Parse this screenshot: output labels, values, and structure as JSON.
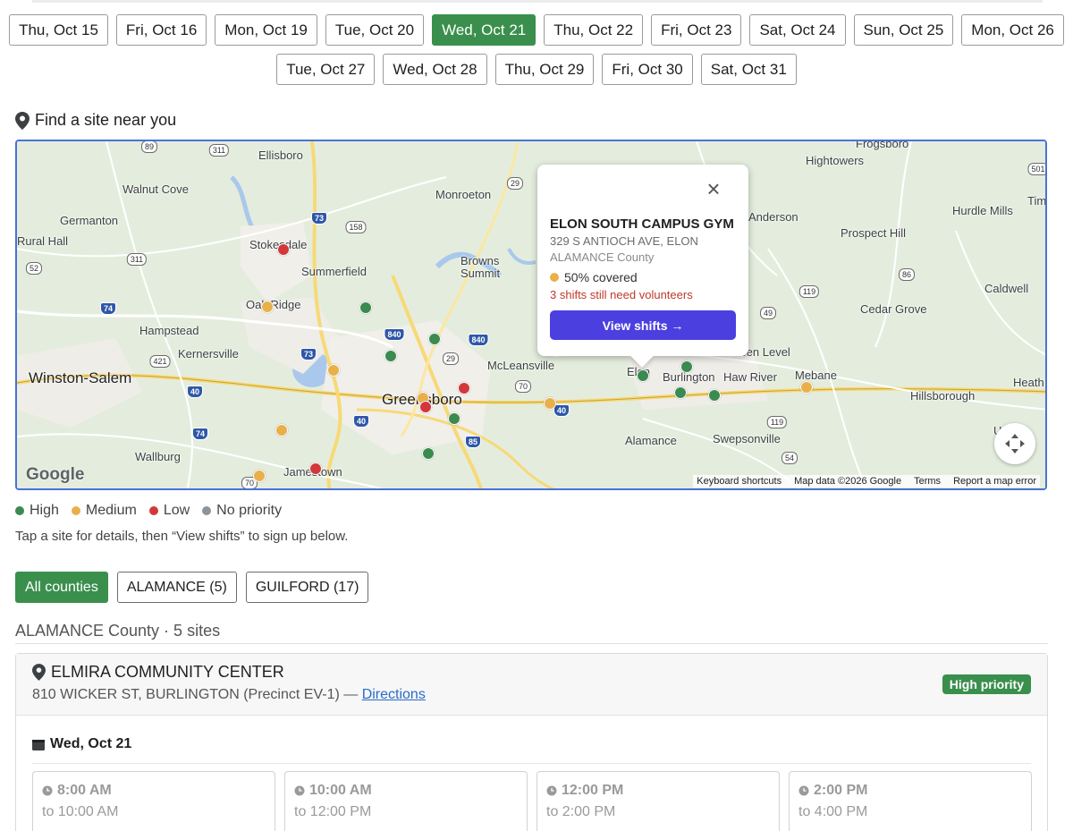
{
  "dates": {
    "row1": [
      "Thu, Oct 15",
      "Fri, Oct 16",
      "Mon, Oct 19",
      "Tue, Oct 20",
      "Wed, Oct 21",
      "Thu, Oct 22",
      "Fri, Oct 23",
      "Sat, Oct 24",
      "Sun, Oct 25",
      "Mon, Oct 26"
    ],
    "row2": [
      "Tue, Oct 27",
      "Wed, Oct 28",
      "Thu, Oct 29",
      "Fri, Oct 30",
      "Sat, Oct 31"
    ],
    "selected": "Wed, Oct 21"
  },
  "map_section": {
    "title": "Find a site near you",
    "towns": [
      "Frogsboro",
      "Hightowers",
      "Ellisboro",
      "Walnut Cove",
      "Monroeton",
      "Germanton",
      "Hurdle Mills",
      "Prospect Hill",
      "Rural Hall",
      "Stokesdale",
      "Summerfield",
      "Browns Summit",
      "Caldwell",
      "Cedar Grove",
      "Oak Ridge",
      "Hampstead",
      "Kernersville",
      "McLeansville",
      "Green Level",
      "Winston-Salem",
      "Burlington",
      "Haw River",
      "Mebane",
      "Hillsborough",
      "Heath",
      "Greensboro",
      "Alamance",
      "Swepsonville",
      "Univer",
      "Wallburg",
      "Jamestown",
      "Elon",
      "Anderson",
      "Tim"
    ],
    "highways": [
      "89",
      "311",
      "29",
      "73",
      "158",
      "52",
      "311",
      "74",
      "421",
      "840",
      "840",
      "29",
      "40",
      "73",
      "70",
      "40",
      "40",
      "74",
      "85",
      "70",
      "119",
      "49",
      "86",
      "119",
      "54",
      "501"
    ],
    "google_logo": "Google",
    "footer": [
      "Keyboard shortcuts",
      "Map data ©2026 Google",
      "Terms",
      "Report a map error"
    ],
    "marker_colors": {
      "high": "#3b8a4f",
      "medium": "#e9b04a",
      "low": "#d2383b",
      "none": "#8e949c"
    },
    "popup": {
      "title": "ELON SOUTH CAMPUS GYM",
      "address": "329 S ANTIOCH AVE, ELON",
      "county": "ALAMANCE County",
      "coverage": "50% covered",
      "need": "3 shifts still need volunteers",
      "button": "View shifts →",
      "close": "×"
    }
  },
  "legend": {
    "items": [
      {
        "label": "High",
        "color": "#3b8a4f"
      },
      {
        "label": "Medium",
        "color": "#e9b04a"
      },
      {
        "label": "Low",
        "color": "#d2383b"
      },
      {
        "label": "No priority",
        "color": "#8e949c"
      }
    ],
    "tip": "Tap a site for details, then “View shifts” to sign up below."
  },
  "counties": {
    "filters": [
      "All counties",
      "ALAMANCE (5)",
      "GUILFORD (17)"
    ],
    "selected": "All counties",
    "heading": "ALAMANCE County · 5 sites"
  },
  "site": {
    "name": "ELMIRA COMMUNITY CENTER",
    "address": "810 WICKER ST, BURLINGTON (Precinct EV-1) — ",
    "directions": "Directions",
    "priority": "High priority",
    "day": "Wed, Oct 21",
    "slots": [
      {
        "start": "8:00 AM",
        "end": "to 10:00 AM"
      },
      {
        "start": "10:00 AM",
        "end": "to 12:00 PM"
      },
      {
        "start": "12:00 PM",
        "end": "to 2:00 PM"
      },
      {
        "start": "2:00 PM",
        "end": "to 4:00 PM"
      }
    ]
  }
}
